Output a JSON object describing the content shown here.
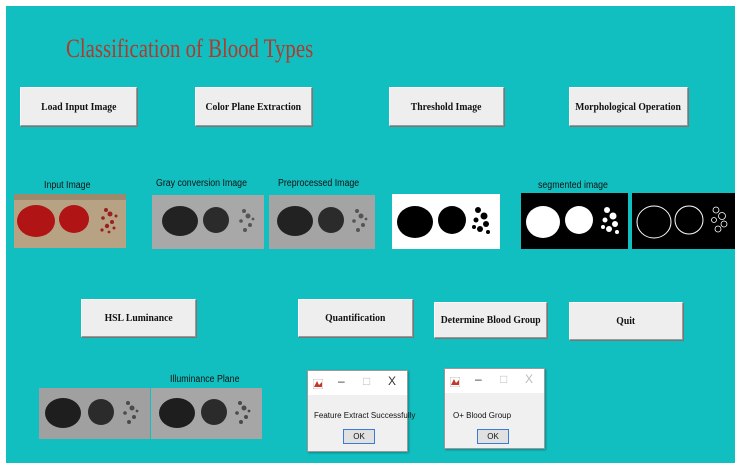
{
  "title": "Classification of Blood Types",
  "buttons": {
    "load_input": "Load Input Image",
    "color_plane": "Color Plane Extraction",
    "threshold": "Threshold Image",
    "morphological": "Morphological Operation",
    "hsl": "HSL Luminance",
    "quantification": "Quantification",
    "determine": "Determine Blood Group",
    "quit": "Quit"
  },
  "labels": {
    "input_image": "Input Image",
    "gray_conversion": "Gray conversion Image",
    "preprocessed": "Preprocessed Image",
    "segmented": "segmented image",
    "illuminance": "Illuminance Plane"
  },
  "dialogs": {
    "feature": {
      "message": "Feature Extract Successfully",
      "ok": "OK"
    },
    "blood_group": {
      "message": "O+ Blood Group",
      "ok": "OK"
    }
  },
  "window_controls": {
    "minimize": "–",
    "maximize": "□",
    "close": "X"
  },
  "colors": {
    "background": "#12bfc0",
    "title": "#b03a2e",
    "blood": "#b01414"
  },
  "icons": [
    "matlab-icon",
    "minimize-icon",
    "maximize-icon",
    "close-icon"
  ]
}
